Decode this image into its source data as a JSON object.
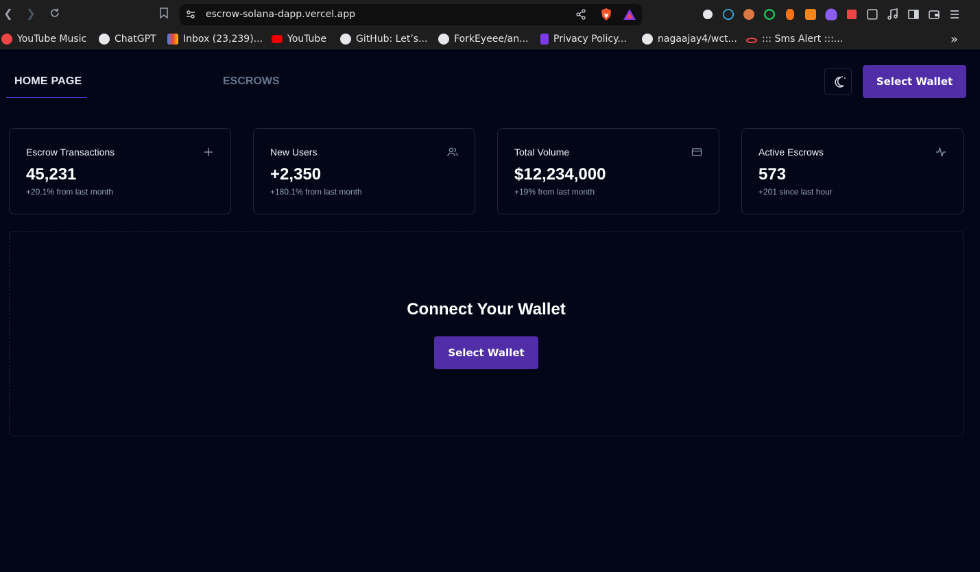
{
  "browser": {
    "url": "escrow-solana-dapp.vercel.app",
    "bookmarks": [
      {
        "label": "YouTube Music",
        "icon": "youtube-music-icon"
      },
      {
        "label": "ChatGPT",
        "icon": "chatgpt-icon"
      },
      {
        "label": "Inbox (23,239)...",
        "icon": "gmail-icon"
      },
      {
        "label": "YouTube",
        "icon": "youtube-icon"
      },
      {
        "label": "GitHub: Let’s...",
        "icon": "github-icon"
      },
      {
        "label": "ForkEyeee/an...",
        "icon": "github-icon"
      },
      {
        "label": "Privacy Policy...",
        "icon": "privacy-icon"
      },
      {
        "label": "nagaajay4/wct...",
        "icon": "github-icon"
      },
      {
        "label": "::: Sms Alert :::...",
        "icon": "sms-alert-icon"
      }
    ],
    "more_label": "»"
  },
  "nav": {
    "home": "HOME PAGE",
    "escrows": "ESCROWS",
    "wallet_button": "Select Wallet"
  },
  "stats": [
    {
      "title": "Escrow Transactions",
      "value": "45,231",
      "sub": "+20.1% from last month",
      "icon": "plus-icon"
    },
    {
      "title": "New Users",
      "value": "+2,350",
      "sub": "+180.1% from last month",
      "icon": "users-icon"
    },
    {
      "title": "Total Volume",
      "value": "$12,234,000",
      "sub": "+19% from last month",
      "icon": "credit-card-icon"
    },
    {
      "title": "Active Escrows",
      "value": "573",
      "sub": "+201 since last hour",
      "icon": "activity-icon"
    }
  ],
  "connect": {
    "title": "Connect Your Wallet",
    "button": "Select Wallet"
  },
  "colors": {
    "background": "#020617",
    "accent": "#512da8",
    "border": "#1e293b",
    "muted": "#94a3b8"
  }
}
